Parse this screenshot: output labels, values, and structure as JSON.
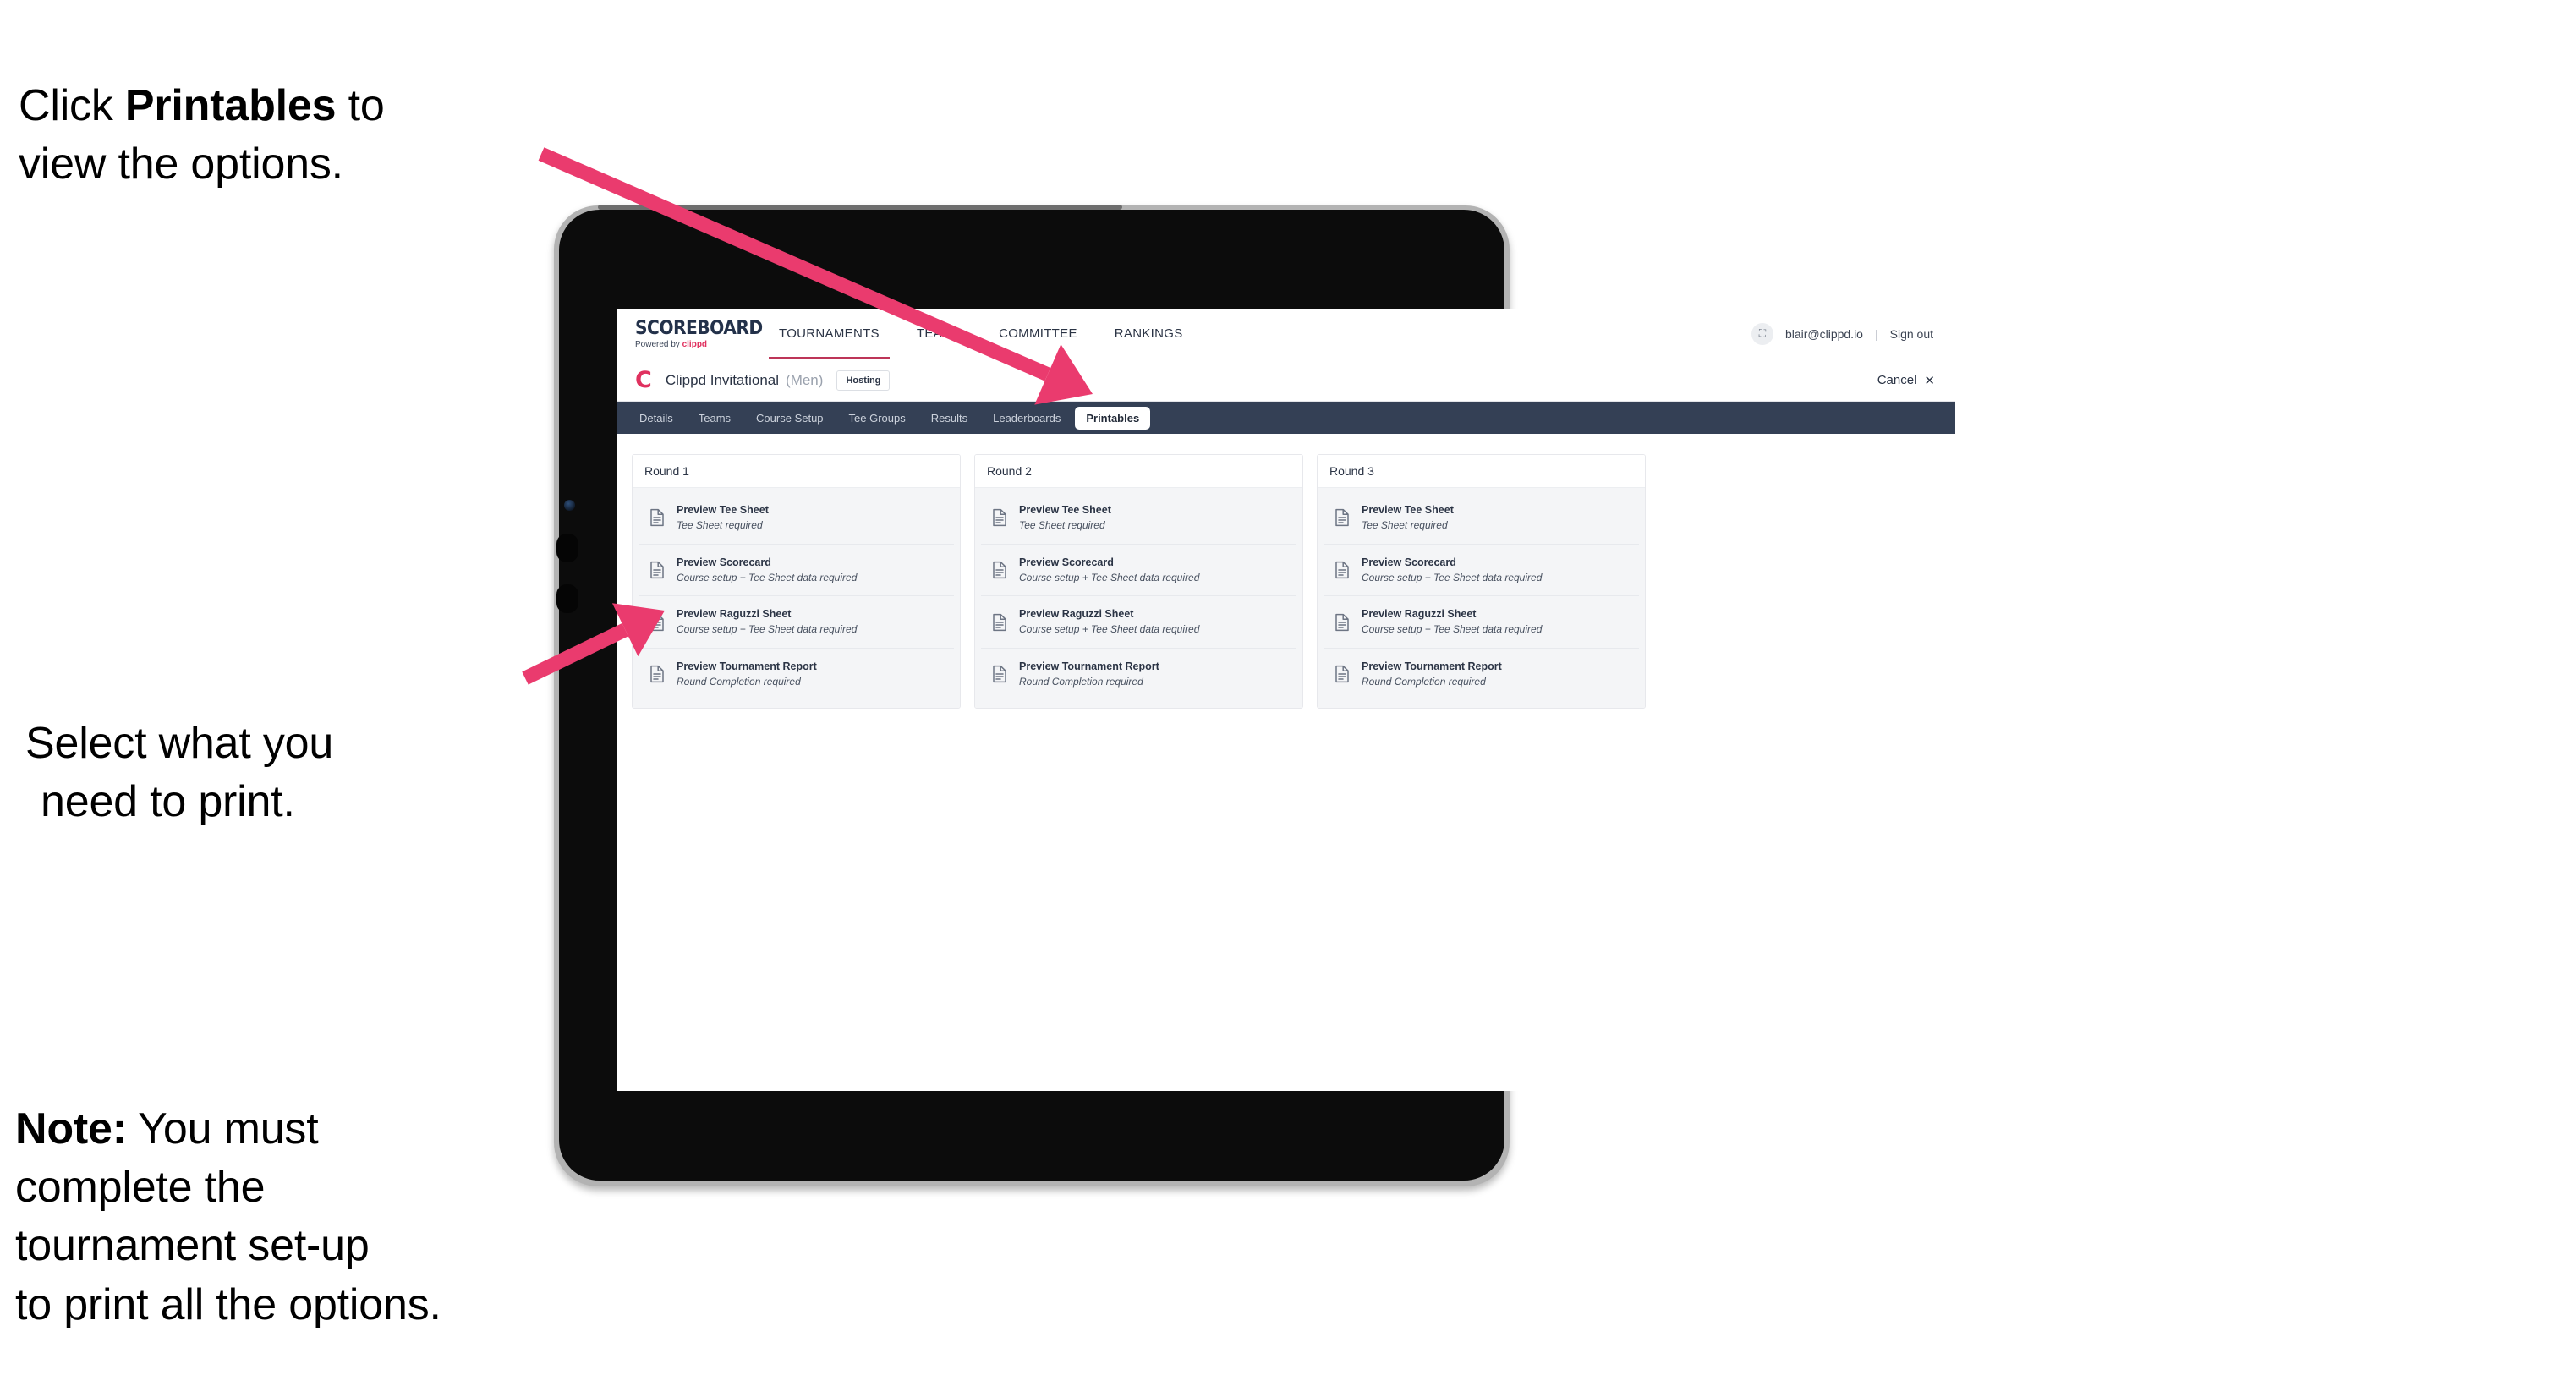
{
  "annotations": {
    "printables_callout": {
      "prefix": "Click ",
      "bold": "Printables",
      "suffix": " to\nview the options."
    },
    "select_callout_line1": "Select what you",
    "select_callout_line2": "need to print.",
    "note_callout": {
      "bold": "Note:",
      "text": " You must\ncomplete the\ntournament set-up\nto print all the options."
    },
    "arrow_color": "#ea3b6e"
  },
  "browser": {
    "brand": {
      "logo_word": "SCOREBOARD",
      "logo_sub_prefix": "Powered by ",
      "logo_sub_brand": "clippd"
    },
    "main_nav": [
      {
        "label": "TOURNAMENTS",
        "active": true
      },
      {
        "label": "TEAMS",
        "active": false
      },
      {
        "label": "COMMITTEE",
        "active": false
      },
      {
        "label": "RANKINGS",
        "active": false
      }
    ],
    "user": {
      "avatar_glyph": "⛶",
      "email": "blair@clippd.io",
      "separator": "|",
      "sign_out": "Sign out"
    },
    "title_bar": {
      "logo_letter": "C",
      "tournament_name": "Clippd Invitational",
      "gender": "(Men)",
      "status_badge": "Hosting",
      "cancel_label": "Cancel",
      "cancel_icon": "✕"
    },
    "sub_nav": [
      {
        "label": "Details",
        "active": false
      },
      {
        "label": "Teams",
        "active": false
      },
      {
        "label": "Course Setup",
        "active": false
      },
      {
        "label": "Tee Groups",
        "active": false
      },
      {
        "label": "Results",
        "active": false
      },
      {
        "label": "Leaderboards",
        "active": false
      },
      {
        "label": "Printables",
        "active": true
      }
    ],
    "rounds": [
      {
        "heading": "Round 1",
        "items": [
          {
            "title": "Preview Tee Sheet",
            "requirement": "Tee Sheet required"
          },
          {
            "title": "Preview Scorecard",
            "requirement": "Course setup + Tee Sheet data required"
          },
          {
            "title": "Preview Raguzzi Sheet",
            "requirement": "Course setup + Tee Sheet data required"
          },
          {
            "title": "Preview Tournament Report",
            "requirement": "Round Completion required"
          }
        ]
      },
      {
        "heading": "Round 2",
        "items": [
          {
            "title": "Preview Tee Sheet",
            "requirement": "Tee Sheet required"
          },
          {
            "title": "Preview Scorecard",
            "requirement": "Course setup + Tee Sheet data required"
          },
          {
            "title": "Preview Raguzzi Sheet",
            "requirement": "Course setup + Tee Sheet data required"
          },
          {
            "title": "Preview Tournament Report",
            "requirement": "Round Completion required"
          }
        ]
      },
      {
        "heading": "Round 3",
        "items": [
          {
            "title": "Preview Tee Sheet",
            "requirement": "Tee Sheet required"
          },
          {
            "title": "Preview Scorecard",
            "requirement": "Course setup + Tee Sheet data required"
          },
          {
            "title": "Preview Raguzzi Sheet",
            "requirement": "Course setup + Tee Sheet data required"
          },
          {
            "title": "Preview Tournament Report",
            "requirement": "Round Completion required"
          }
        ]
      }
    ]
  },
  "colors": {
    "accent_pink": "#e0315f",
    "subnav_dark": "#344055",
    "text_dark": "#2b3445",
    "card_bg": "#f4f5f7"
  }
}
